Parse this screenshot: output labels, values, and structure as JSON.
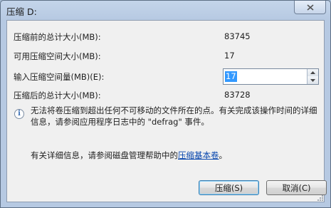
{
  "window": {
    "title": "压缩 D:"
  },
  "fields": [
    {
      "label": "压缩前的总计大小(MB):",
      "value": "83745"
    },
    {
      "label": "可用压缩空间大小(MB):",
      "value": "17"
    },
    {
      "label": "输入压缩空间量(MB)(E):",
      "value": "17"
    },
    {
      "label": "压缩后的总计大小(MB):",
      "value": "83728"
    }
  ],
  "info": {
    "icon": "info-icon",
    "text": "无法将卷压缩到超出任何不可移动的文件所在的点。有关完成该操作时间的详细信息，请参阅应用程序日志中的 \"defrag\" 事件。"
  },
  "help": {
    "text": "有关详细信息，请参阅磁盘管理帮助中的",
    "link": "压缩基本卷",
    "suffix": "。"
  },
  "buttons": {
    "shrink": "压缩(S)",
    "cancel": "取消(C)"
  }
}
